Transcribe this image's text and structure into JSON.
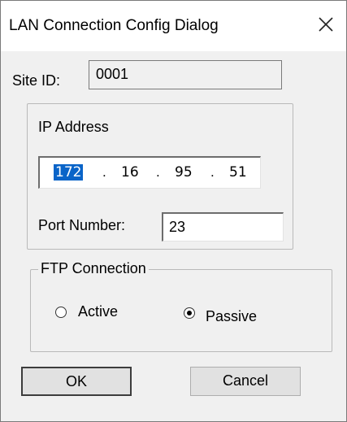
{
  "dialog": {
    "title": "LAN Connection Config Dialog",
    "close_icon": "close-icon"
  },
  "site": {
    "label": "Site ID:",
    "value": "0001"
  },
  "ip": {
    "group_label": "IP Address",
    "octets": [
      "172",
      "16",
      "95",
      "51"
    ],
    "separator": ".",
    "port_label": "Port Number:",
    "port_value": "23"
  },
  "ftp": {
    "group_label": "FTP Connection",
    "options": [
      {
        "label": "Active",
        "selected": false
      },
      {
        "label": "Passive",
        "selected": true
      }
    ]
  },
  "buttons": {
    "ok_label": "OK",
    "cancel_label": "Cancel"
  },
  "colors": {
    "selection": "#0a64c8"
  }
}
